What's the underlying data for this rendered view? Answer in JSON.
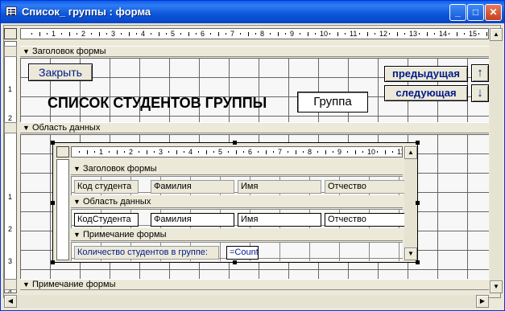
{
  "window": {
    "title": "Список_ группы : форма",
    "minimize": "_",
    "maximize": "□",
    "close": "✕"
  },
  "ruler": {
    "numbers": [
      "1",
      "2",
      "3",
      "4",
      "5",
      "6",
      "7",
      "8",
      "9",
      "10",
      "11",
      "12",
      "13",
      "14",
      "15"
    ],
    "v_numbers": [
      "1",
      "2",
      "1",
      "2",
      "3",
      "4"
    ]
  },
  "sections": {
    "header": "Заголовок формы",
    "detail": "Область данных",
    "footer": "Примечание формы"
  },
  "header_controls": {
    "close_button": "Закрыть",
    "title_label": "СПИСОК СТУДЕНТОВ ГРУППЫ",
    "group_box": "Группа",
    "prev_button": "предыдущая",
    "next_button": "следующая",
    "up_arrow": "↑",
    "down_arrow": "↓"
  },
  "subform": {
    "ruler_numbers": [
      "1",
      "2",
      "3",
      "4",
      "5",
      "6",
      "7",
      "8",
      "9",
      "10",
      "11"
    ],
    "header_band": "Заголовок формы",
    "detail_band": "Область данных",
    "footer_band": "Примечание формы",
    "header_labels": [
      "Код студента",
      "Фамилия",
      "Имя",
      "Отчество"
    ],
    "detail_fields": [
      "КодСтудента",
      "Фамилия",
      "Имя",
      "Отчество"
    ],
    "footer_label": "Количество студентов в группе:",
    "footer_expr": "=Count"
  },
  "colors": {
    "title_bar": "#0a5ee8",
    "accent_text": "#001a8c"
  }
}
